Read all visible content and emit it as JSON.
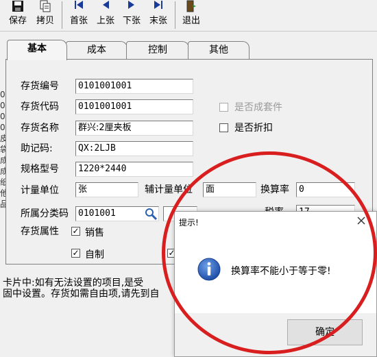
{
  "toolbar": {
    "save_label": "保存",
    "copy_label": "拷贝",
    "first_label": "首张",
    "prev_label": "上张",
    "next_label": "下张",
    "last_label": "末张",
    "exit_label": "退出"
  },
  "tabs": [
    "基本",
    "成本",
    "控制",
    "其他"
  ],
  "form": {
    "inventory_code_label": "存货编号",
    "inventory_code_value": "0101001001",
    "inventory_alias_label": "存货代码",
    "inventory_alias_value": "0101001001",
    "inventory_name_label": "存货名称",
    "inventory_name_value": "群兴:2厘夹板",
    "mnemonic_label": "助记码:",
    "mnemonic_value": "QX:2LJB",
    "spec_label": "规格型号",
    "spec_value": "1220*2440",
    "unit_label": "计量单位",
    "unit_value": "张",
    "aux_unit_label": "辅计量单位",
    "aux_unit_value": "面",
    "conversion_label": "换算率",
    "conversion_value": "0",
    "category_label": "所属分类码",
    "category_value": "0101001",
    "tax_label": "税率",
    "tax_value": "17",
    "attribute_label": "存货属性",
    "is_kit_label": "是否成套件",
    "is_discount_label": "是否折扣",
    "sales_label": "销售",
    "self_made_label": "自制"
  },
  "left_strip": [
    "0",
    "0",
    "0",
    "0",
    "皮",
    "袋",
    "成",
    "成",
    "纸",
    "他",
    "品"
  ],
  "bottom_note": {
    "line1": "卡片中:如有无法设置的项目,是受",
    "line2": "固中设置。存货如需自由项,请先到自"
  },
  "dialog": {
    "title": "提示!",
    "message": "换算率不能小于等于零!",
    "ok_label": "确定"
  },
  "colors": {
    "annotation_circle": "#d81e1e",
    "info_icon": "#2a5fb0"
  }
}
